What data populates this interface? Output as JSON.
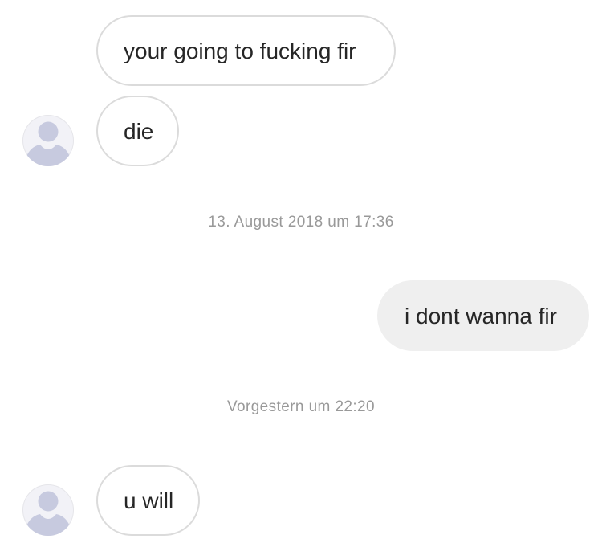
{
  "thread": {
    "messages": [
      {
        "direction": "incoming",
        "text": "your going to fucking fir"
      },
      {
        "direction": "incoming",
        "text": "die"
      },
      {
        "direction": "outgoing",
        "text": "i dont wanna fir"
      },
      {
        "direction": "incoming",
        "text": "u will"
      }
    ],
    "timestamps": [
      "13. August 2018 um 17:36",
      "Vorgestern um 22:20"
    ]
  },
  "avatar": {
    "icon": "default-user-silhouette-icon",
    "colors": {
      "silhouette": "#c7cadf",
      "background": "#f2f2f7"
    }
  },
  "colors": {
    "incoming_bubble_border": "#dbdbdb",
    "outgoing_bubble_fill": "#efefef",
    "text": "#262626",
    "timestamp_text": "#999999"
  }
}
